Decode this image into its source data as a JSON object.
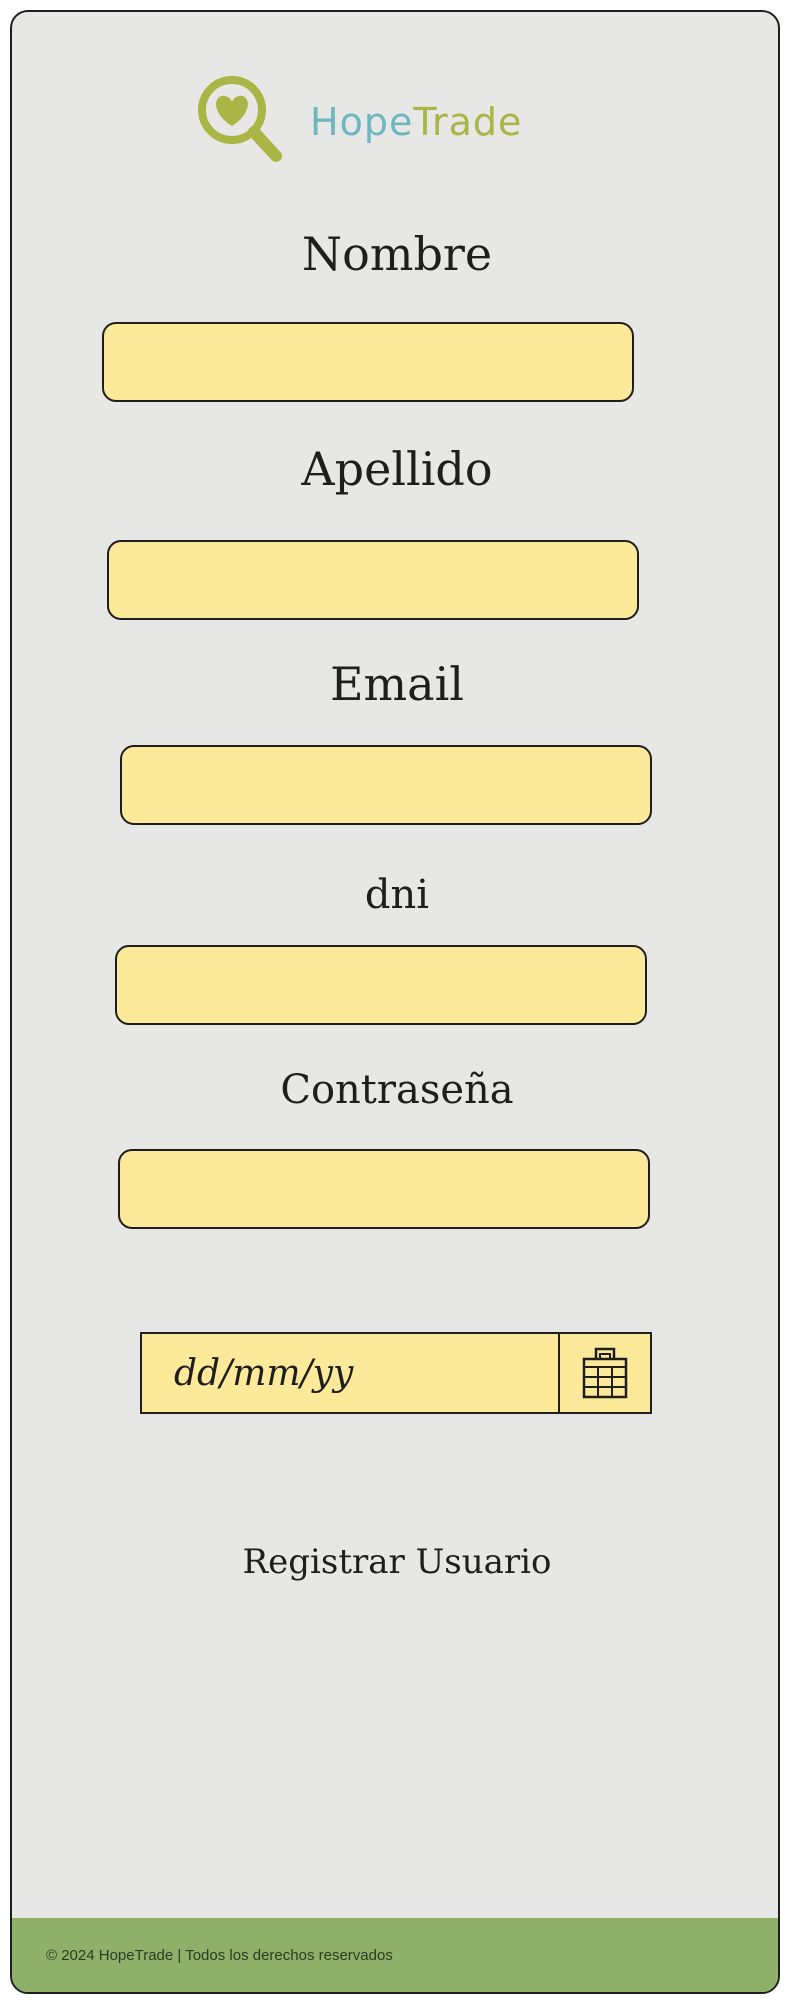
{
  "brand": {
    "name_part1": "Hope",
    "name_part2": "Trade",
    "primary_color": "#6fb6bf",
    "secondary_color": "#a9b645",
    "icon": "heart-magnifier-icon"
  },
  "form": {
    "nombre_label": "Nombre",
    "apellido_label": "Apellido",
    "email_label": "Email",
    "dni_label": "dni",
    "password_label": "Contraseña",
    "date_placeholder": "dd/mm/yy",
    "calendar_icon": "calendar-icon",
    "field_color": "#fde99a"
  },
  "actions": {
    "register_label": "Registrar Usuario"
  },
  "footer": {
    "text": "© 2024 HopeTrade | Todos los derechos reservados",
    "color": "#8fb069"
  }
}
